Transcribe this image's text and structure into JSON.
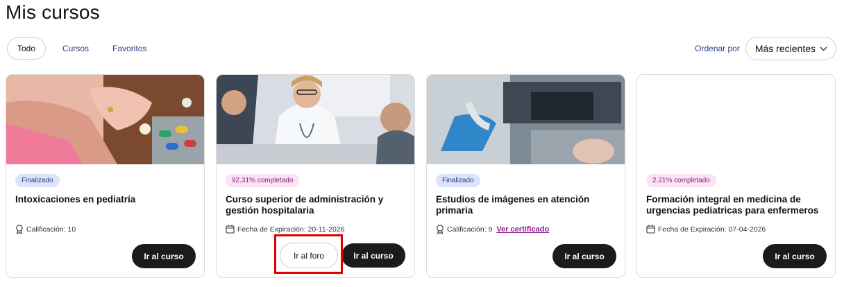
{
  "page": {
    "title": "Mis cursos"
  },
  "filters": {
    "tabs": [
      "Todo",
      "Cursos",
      "Favoritos"
    ],
    "active": "Todo"
  },
  "sort": {
    "label": "Ordenar por",
    "value": "Más recientes"
  },
  "colors": {
    "badge_done_bg": "#dde3fb",
    "badge_progress_bg": "#fbe3f5",
    "cert_link": "#8a1e8a",
    "highlight": "#e00000"
  },
  "cards": [
    {
      "badge": "Finalizado",
      "title": "Intoxicaciones en pediatría",
      "meta_icon": "award-icon",
      "meta": "Calificación: 10",
      "primary_button": "Ir al curso"
    },
    {
      "badge": "92.31% completado",
      "title": "Curso superior de administración y gestión hospitalaria",
      "meta_icon": "calendar-icon",
      "meta": "Fecha de Expiración: 20-11-2026",
      "secondary_button": "Ir al foro",
      "primary_button": "Ir al curso"
    },
    {
      "badge": "Finalizado",
      "title": "Estudios de imágenes en atención primaria",
      "meta_icon": "award-icon",
      "meta": "Calificación: 9",
      "link": "Ver certificado",
      "primary_button": "Ir al curso"
    },
    {
      "badge": "2.21% completado",
      "title": "Formación integral en medicina de urgencias pediatricas para enfermeros",
      "meta_icon": "calendar-icon",
      "meta": "Fecha de Expiración: 07-04-2026",
      "primary_button": "Ir al curso"
    }
  ]
}
